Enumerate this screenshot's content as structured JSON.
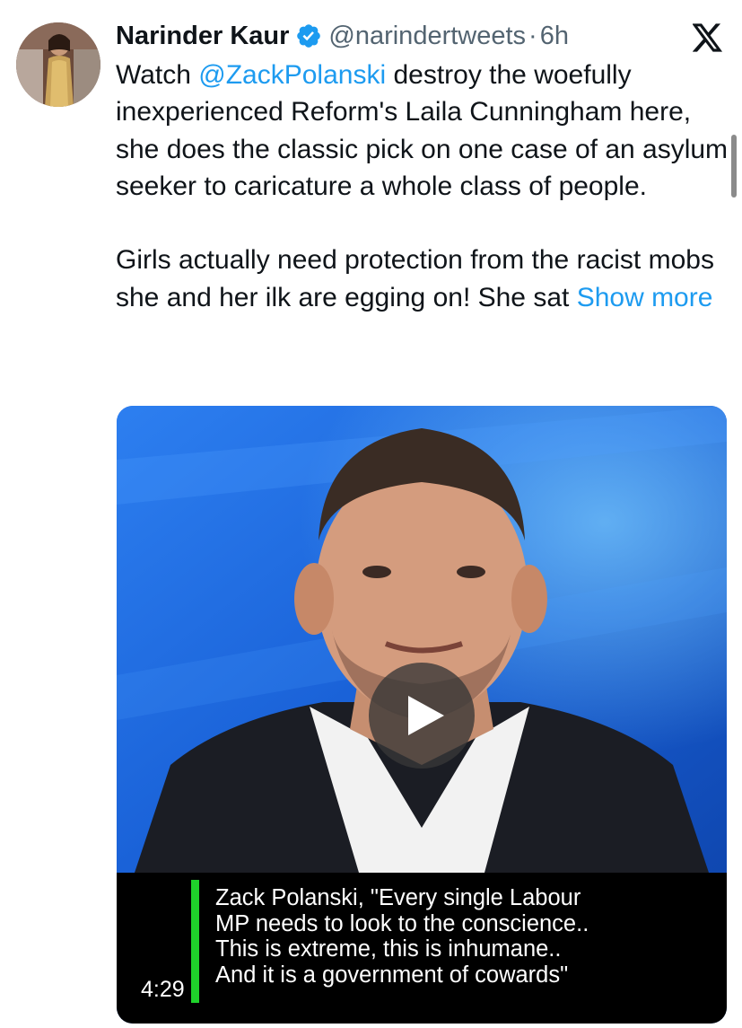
{
  "post": {
    "author": {
      "display_name": "Narinder Kaur",
      "handle": "@narindertweets",
      "separator": "·",
      "time": "6h",
      "verified_icon": "verified-badge-icon",
      "verified_color": "#1d9bf0"
    },
    "platform_icon": "x-logo-icon",
    "body": {
      "p1_before": "Watch ",
      "mention": "@ZackPolanski",
      "p1_after": "  destroy the woefully inexperienced Reform's Laila Cunningham here, she does the classic pick on one case of an asylum seeker  to caricature a whole class of people.",
      "p2_text": "Girls actually need protection from the racist mobs she and her ilk are egging on! She sat ",
      "show_more": "Show more"
    },
    "media": {
      "type": "video",
      "duration": "4:29",
      "play_icon": "play-icon",
      "caption_lines": [
        "Zack Polanski, \"Every single Labour",
        "MP needs to look to the conscience..",
        "This is extreme, this is inhumane..",
        "And it is a government of cowards\""
      ],
      "caption_accent_color": "#1fd22b"
    }
  },
  "colors": {
    "link": "#1d9bf0",
    "text": "#0f1419",
    "secondary": "#536471"
  }
}
